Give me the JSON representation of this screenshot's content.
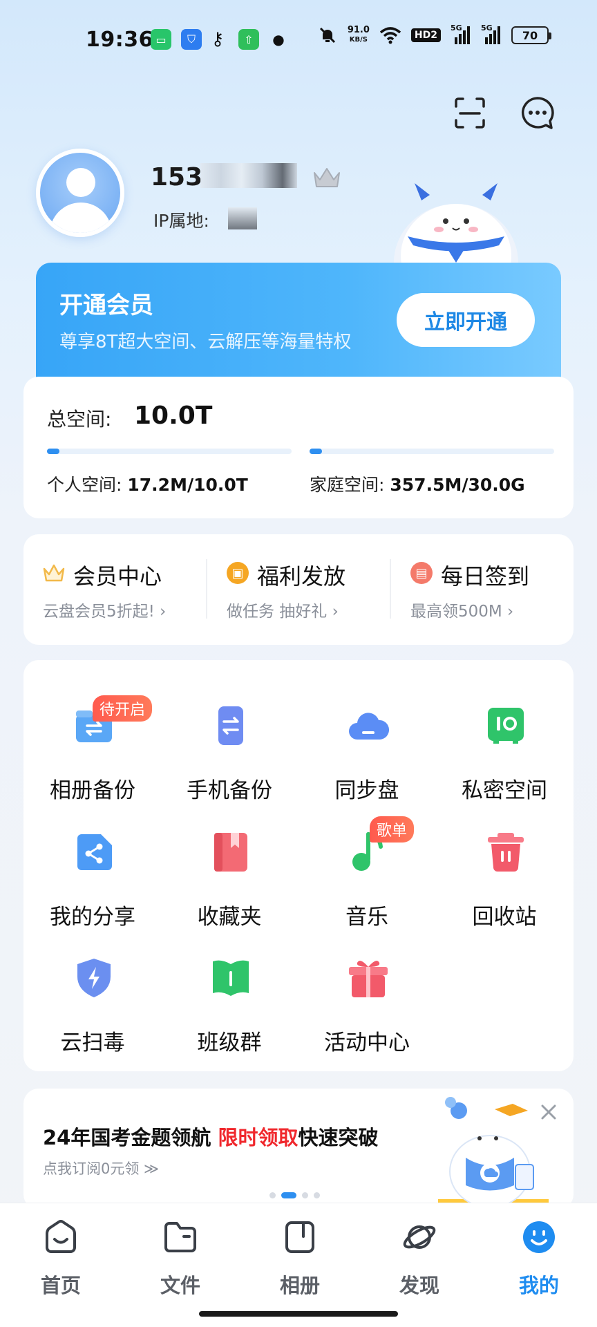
{
  "status_bar": {
    "time": "19:36",
    "net_speed_value": "91.0",
    "net_speed_unit": "KB/S",
    "hd_label": "HD2",
    "sim1": "5G",
    "sim2": "5G",
    "battery": "70"
  },
  "profile": {
    "phone_prefix": "153",
    "ip_label": "IP属地:"
  },
  "vip_banner": {
    "title": "开通会员",
    "subtitle": "尊享8T超大空间、云解压等海量特权",
    "button": "立即开通"
  },
  "storage": {
    "total_label": "总空间:",
    "total_value": "10.0T",
    "personal_label": "个人空间:",
    "personal_value": "17.2M/10.0T",
    "personal_fraction": 0.0017,
    "family_label": "家庭空间:",
    "family_value": "357.5M/30.0G",
    "family_fraction": 0.0119
  },
  "perks": [
    {
      "title": "会员中心",
      "sub": "云盘会员5折起!",
      "icon": "crown-icon",
      "color": "#f2b94a"
    },
    {
      "title": "福利发放",
      "sub": "做任务 抽好礼",
      "icon": "gift-icon",
      "color": "#f5a623"
    },
    {
      "title": "每日签到",
      "sub": "最高领500M",
      "icon": "calendar-icon",
      "color": "#f47a6a"
    }
  ],
  "tools": [
    {
      "label": "相册备份",
      "tag": "待开启",
      "icon": "album-backup-icon"
    },
    {
      "label": "手机备份",
      "tag": "",
      "icon": "phone-backup-icon"
    },
    {
      "label": "同步盘",
      "tag": "",
      "icon": "cloud-sync-icon"
    },
    {
      "label": "私密空间",
      "tag": "",
      "icon": "safe-icon"
    },
    {
      "label": "我的分享",
      "tag": "",
      "icon": "share-icon"
    },
    {
      "label": "收藏夹",
      "tag": "",
      "icon": "bookmark-icon"
    },
    {
      "label": "音乐",
      "tag": "歌单",
      "icon": "music-icon"
    },
    {
      "label": "回收站",
      "tag": "",
      "icon": "trash-icon"
    },
    {
      "label": "云扫毒",
      "tag": "",
      "icon": "shield-icon"
    },
    {
      "label": "班级群",
      "tag": "",
      "icon": "class-book-icon"
    },
    {
      "label": "活动中心",
      "tag": "",
      "icon": "gift-box-icon"
    }
  ],
  "ad": {
    "title_part1": "24年国考金题领航 ",
    "title_red": "限时领取",
    "title_part2": "快速突破",
    "sub": "点我订阅0元领 ≫"
  },
  "nav": [
    {
      "label": "首页",
      "icon": "home-icon"
    },
    {
      "label": "文件",
      "icon": "folder-icon"
    },
    {
      "label": "相册",
      "icon": "album-icon"
    },
    {
      "label": "发现",
      "icon": "planet-icon"
    },
    {
      "label": "我的",
      "icon": "smiley-icon",
      "active": true
    }
  ]
}
